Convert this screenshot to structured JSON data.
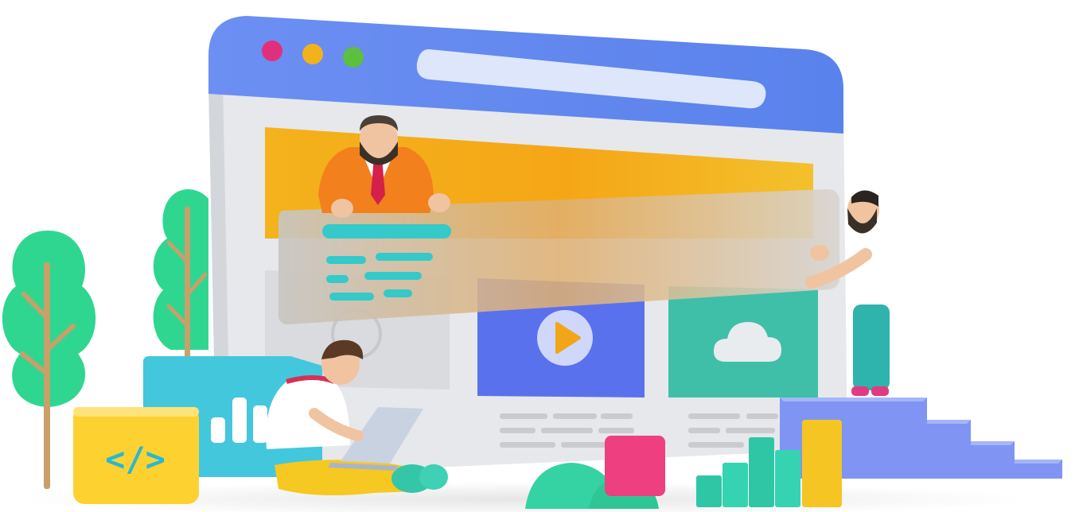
{
  "illustration": {
    "code_symbol": "</>",
    "colors": {
      "browser_frame": "#6b8ff0",
      "browser_body": "#e9ebee",
      "address_bar": "#dfe7fb",
      "dot_red": "#e0307d",
      "dot_yellow": "#f2b21c",
      "dot_green": "#5cbf3e",
      "banner_orange": "#f2a516",
      "text_lines": "#35c9c9",
      "video_tile": "#5a71ee",
      "cloud_tile": "#3fbfa8",
      "tree_green": "#2fd690",
      "code_cube": "#ffd430",
      "stairs": "#7f94f3",
      "pink_cube": "#ee3f80"
    },
    "icons": [
      "play-icon",
      "cloud-icon",
      "bar-chart-icon",
      "code-icon"
    ]
  }
}
